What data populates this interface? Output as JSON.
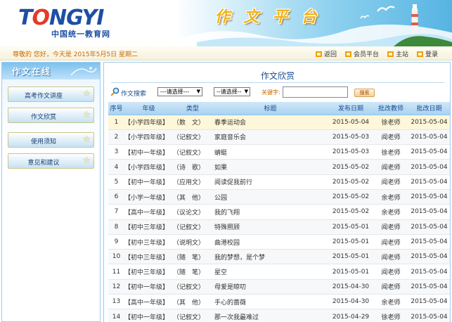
{
  "header": {
    "logo_main_prefix": "T",
    "logo_main_o": "O",
    "logo_main_suffix": "NGYI",
    "logo_sub": "中国统一教育网",
    "platform_chars": [
      "作",
      "文",
      "平",
      "台"
    ]
  },
  "infobar": {
    "greeting": "尊敬的 您好，今天是 2015年5月5日 星期二",
    "links": [
      "返回",
      "会员平台",
      "主站",
      "登录"
    ]
  },
  "sidebar": {
    "title": "作文在线",
    "items": [
      "高考作文讲座",
      "作文欣赏",
      "使用须知",
      "意见和建议"
    ]
  },
  "main": {
    "title": "作文欣赏",
    "search": {
      "label": "作文搜索",
      "grade_select": "---请选择---",
      "type_select": "--请选择--",
      "keyword_label": "关键字:",
      "keyword_value": "",
      "button": "搜索"
    },
    "columns": [
      "序号",
      "年级",
      "类型",
      "标题",
      "发布日期",
      "批改教师",
      "批改日期"
    ],
    "rows": [
      [
        "1",
        "【小学四年级】",
        "（数　文）",
        "春季运动会",
        "2015-05-04",
        "徐老师",
        "2015-05-04"
      ],
      [
        "2",
        "【小学四年级】",
        "（记叙文）",
        "家庭音乐会",
        "2015-05-03",
        "闻老师",
        "2015-05-04"
      ],
      [
        "3",
        "【初中一年级】",
        "（记叙文）",
        "蜻蜓",
        "2015-05-03",
        "徐老师",
        "2015-05-04"
      ],
      [
        "4",
        "【小学四年级】",
        "（诗　歌）",
        "如果",
        "2015-05-02",
        "闻老师",
        "2015-05-04"
      ],
      [
        "5",
        "【初中一年级】",
        "（应用文）",
        "阅读促我前行",
        "2015-05-02",
        "闻老师",
        "2015-05-04"
      ],
      [
        "6",
        "【小学一年级】",
        "（其　他）",
        "公园",
        "2015-05-02",
        "余老师",
        "2015-05-04"
      ],
      [
        "7",
        "【高中一年级】",
        "（议论文）",
        "我的飞翔",
        "2015-05-02",
        "余老师",
        "2015-05-04"
      ],
      [
        "8",
        "【初中三年级】",
        "（记叙文）",
        "特殊照顾",
        "2015-05-01",
        "闻老师",
        "2015-05-04"
      ],
      [
        "9",
        "【初中三年级】",
        "（说明文）",
        "曲港校园",
        "2015-05-01",
        "闻老师",
        "2015-05-04"
      ],
      [
        "10",
        "【初中三年级】",
        "（随　笔）",
        "我的梦想，是个梦",
        "2015-05-01",
        "闻老师",
        "2015-05-04"
      ],
      [
        "11",
        "【初中三年级】",
        "（随　笔）",
        "星空",
        "2015-05-01",
        "闻老师",
        "2015-05-04"
      ],
      [
        "12",
        "【初中一年级】",
        "（记叙文）",
        "母爱是晾叨",
        "2015-04-30",
        "闻老师",
        "2015-05-04"
      ],
      [
        "13",
        "【高中一年级】",
        "（其　他）",
        "手心的蔷薇",
        "2015-04-30",
        "余老师",
        "2015-05-04"
      ],
      [
        "14",
        "【初中一年级】",
        "（记叙文）",
        "那一次我最难过",
        "2015-04-29",
        "徐老师",
        "2015-05-04"
      ]
    ]
  }
}
